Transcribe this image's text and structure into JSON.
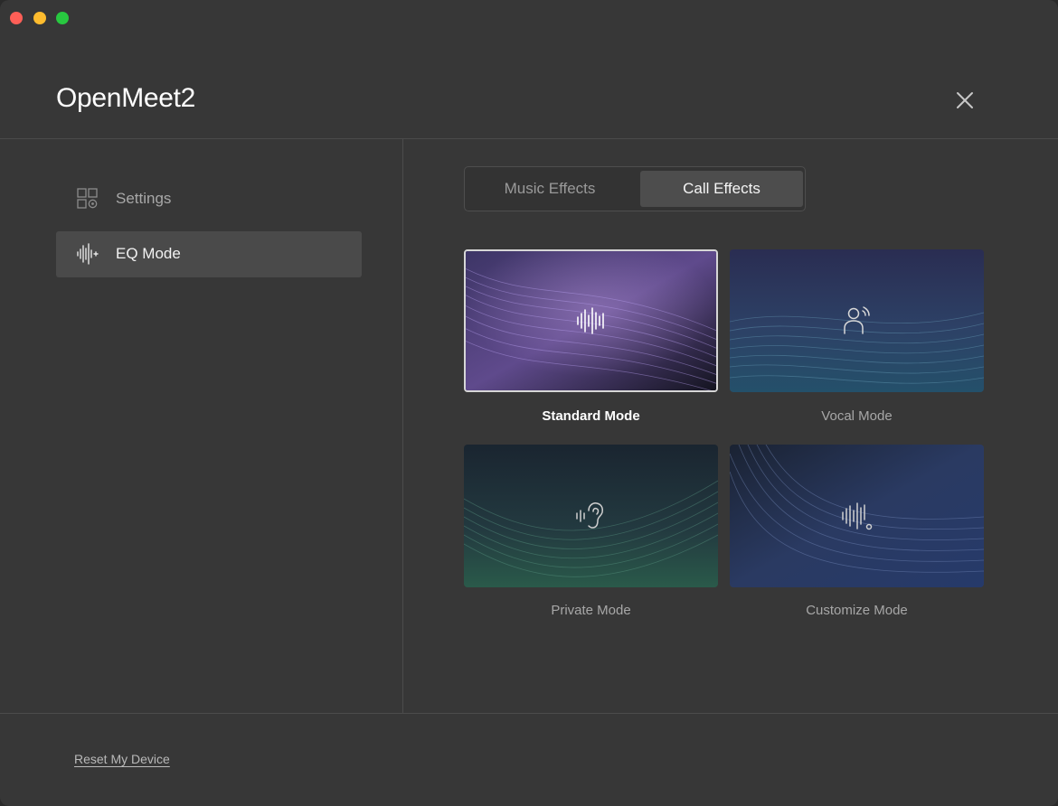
{
  "app": {
    "title": "OpenMeet2"
  },
  "sidebar": {
    "items": [
      {
        "label": "Settings",
        "icon": "settings-grid-icon",
        "active": false
      },
      {
        "label": "EQ Mode",
        "icon": "eq-wave-icon",
        "active": true
      }
    ]
  },
  "tabs": [
    {
      "label": "Music Effects",
      "active": false
    },
    {
      "label": "Call Effects",
      "active": true
    }
  ],
  "modes": [
    {
      "label": "Standard Mode",
      "icon": "waveform-icon",
      "selected": true
    },
    {
      "label": "Vocal Mode",
      "icon": "person-voice-icon",
      "selected": false
    },
    {
      "label": "Private Mode",
      "icon": "ear-icon",
      "selected": false
    },
    {
      "label": "Customize Mode",
      "icon": "custom-waveform-icon",
      "selected": false
    }
  ],
  "footer": {
    "reset_label": "Reset My Device"
  },
  "colors": {
    "window_bg": "#373737",
    "active_item": "#4a4a4a",
    "divider": "#4b4b4b"
  }
}
